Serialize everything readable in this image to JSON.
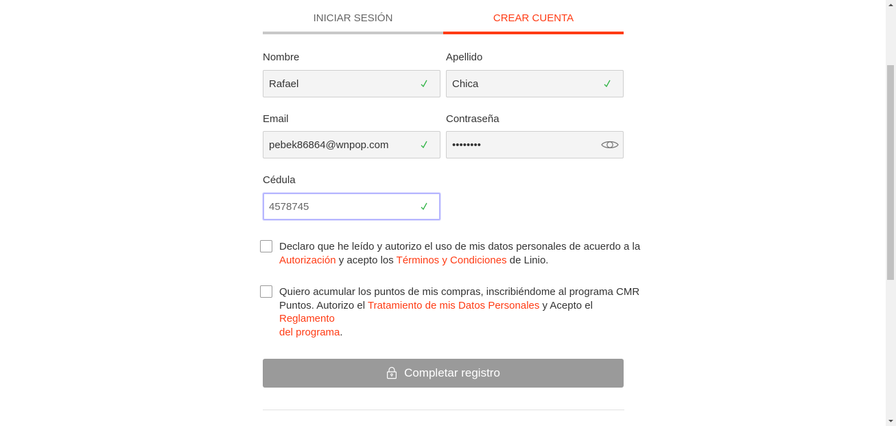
{
  "tabs": {
    "login": "INICIAR SESIÓN",
    "signup": "CREAR CUENTA"
  },
  "form": {
    "nombre": {
      "label": "Nombre",
      "value": "Rafael"
    },
    "apellido": {
      "label": "Apellido",
      "value": "Chica"
    },
    "email": {
      "label": "Email",
      "value": "pebek86864@wnpop.com"
    },
    "password": {
      "label": "Contraseña",
      "value": "••••••••"
    },
    "cedula": {
      "label": "Cédula",
      "value": "4578745"
    }
  },
  "consent1": {
    "text1": "Declaro que he leído y autorizo el uso de mis datos personales de acuerdo a la",
    "link1": "Autorización",
    "text2": " y acepto los ",
    "link2": "Términos y Condiciones",
    "text3": " de Linio."
  },
  "consent2": {
    "text1": "Quiero acumular los puntos de mis compras, inscribiéndome al programa CMR",
    "text2": "Puntos. Autorizo el ",
    "link1": "Tratamiento de mis Datos Personales",
    "text3": " y Acepto el ",
    "link2": "Reglamento",
    "link3": "del programa",
    "text4": "."
  },
  "submit": {
    "label": "Completar registro"
  },
  "colors": {
    "accent": "#ff3b14",
    "valid": "#2fb344",
    "button": "#9a9a9a"
  },
  "icons": {
    "valid": "check-icon",
    "password_toggle": "eye-icon",
    "submit": "lock-icon"
  }
}
